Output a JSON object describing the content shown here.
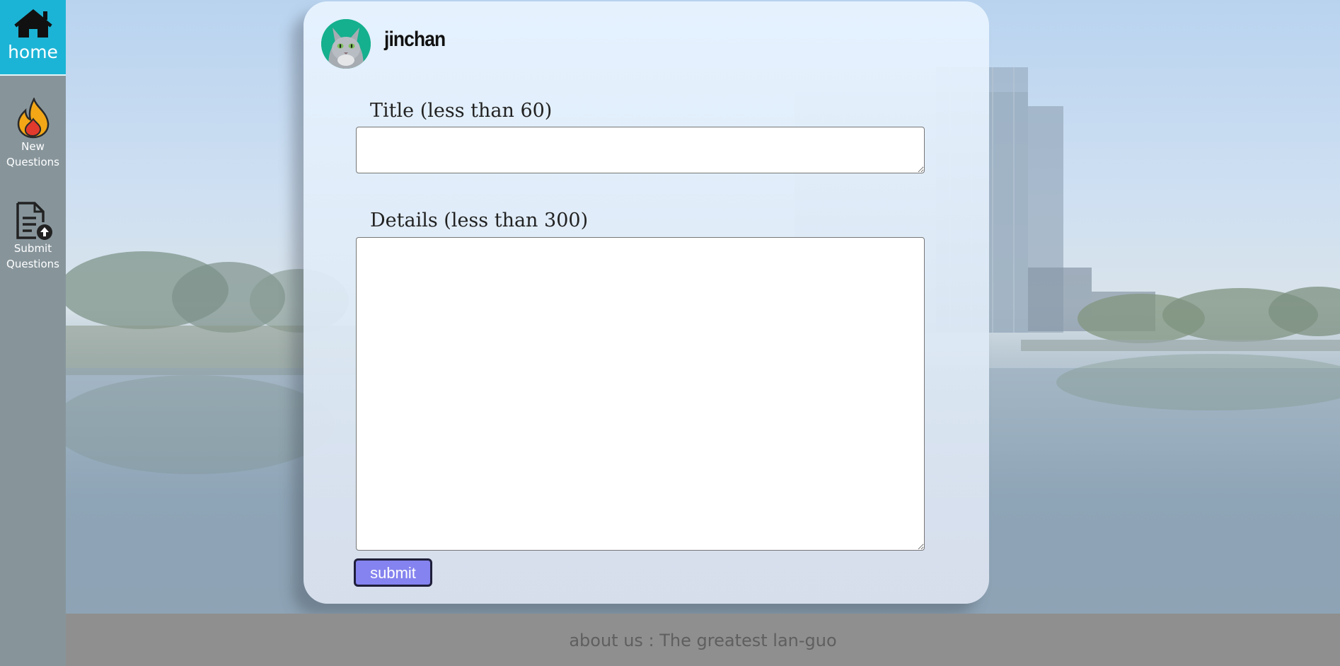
{
  "sidebar": {
    "home_label": "home",
    "home_icon": "house-icon",
    "items": [
      {
        "label": "New Questions",
        "icon": "fire-icon"
      },
      {
        "label": "Submit Questions",
        "icon": "upload-document-icon"
      }
    ]
  },
  "card": {
    "username": "jinchan",
    "avatar_icon": "cat-avatar",
    "title_label": "Title (less than 60)",
    "title_value": "",
    "details_label": "Details (less than 300)",
    "details_value": "",
    "submit_label": "submit"
  },
  "footer": {
    "text": "about us : The greatest lan-guo"
  },
  "colors": {
    "home_bg": "#1cb4d6",
    "sidebar_bg": "#87959b",
    "submit_bg": "#8583ef",
    "footer_bg": "#8f8f8f",
    "avatar_bg": "#15b08e"
  }
}
